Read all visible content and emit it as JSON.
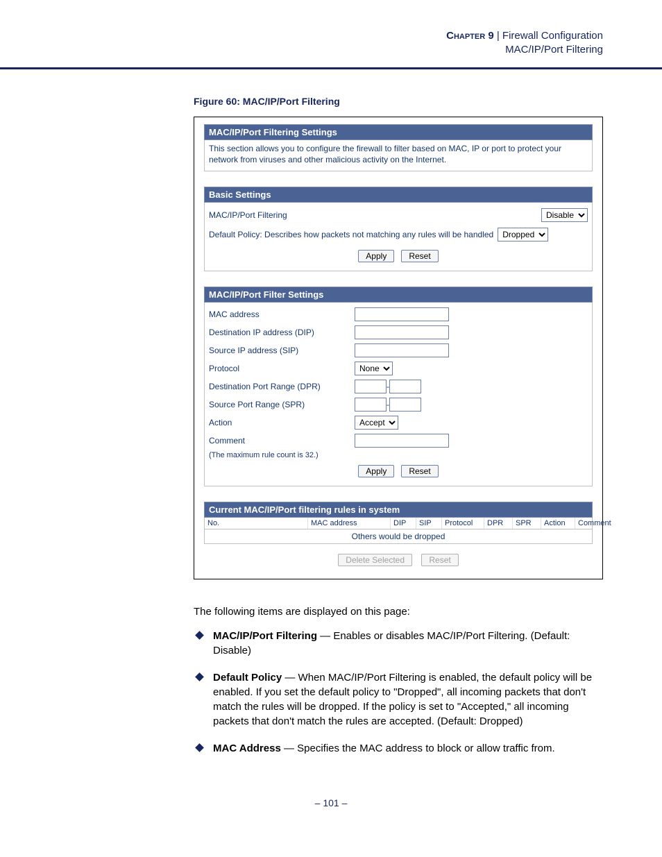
{
  "header": {
    "chapter": "Chapter 9",
    "sep": "  |  ",
    "title": "Firewall Configuration",
    "subtitle": "MAC/IP/Port Filtering"
  },
  "figure_caption": "Figure 60:  MAC/IP/Port Filtering",
  "panel1": {
    "title": "MAC/IP/Port Filtering Settings",
    "desc": "This section allows you to configure the firewall to filter based on MAC, IP or port to protect your network from viruses and other malicious activity on the Internet."
  },
  "panel2": {
    "title": "Basic Settings",
    "row1_label": "MAC/IP/Port Filtering",
    "row1_value": "Disable",
    "row2_label": "Default Policy: Describes how packets not matching any rules will be handled",
    "row2_value": "Dropped",
    "apply": "Apply",
    "reset": "Reset"
  },
  "panel3": {
    "title": "MAC/IP/Port Filter Settings",
    "fields": {
      "mac": "MAC address",
      "dip": "Destination IP address (DIP)",
      "sip": "Source IP address (SIP)",
      "proto": "Protocol",
      "proto_value": "None",
      "dpr": "Destination Port Range (DPR)",
      "spr": "Source Port Range (SPR)",
      "action": "Action",
      "action_value": "Accept",
      "comment": "Comment"
    },
    "note": "(The maximum rule count is 32.)",
    "apply": "Apply",
    "reset": "Reset"
  },
  "panel4": {
    "title": "Current MAC/IP/Port filtering rules in system",
    "cols": [
      "No.",
      "MAC address",
      "DIP",
      "SIP",
      "Protocol",
      "DPR",
      "SPR",
      "Action",
      "Comment"
    ],
    "msg": "Others would be dropped",
    "del": "Delete Selected",
    "reset": "Reset"
  },
  "body": {
    "intro": "The following items are displayed on this page:",
    "items": [
      {
        "term": "MAC/IP/Port Filtering",
        "text": " — Enables or disables MAC/IP/Port Filtering. (Default: Disable)"
      },
      {
        "term": "Default Policy",
        "text": " — When MAC/IP/Port Filtering is enabled, the default policy will be enabled. If you set the default policy to \"Dropped\", all incoming packets that don't match the rules will be dropped. If the policy is set to \"Accepted,\" all incoming packets that don't match the rules are accepted. (Default: Dropped)"
      },
      {
        "term": "MAC Address",
        "text": " — Specifies the MAC address to block or allow traffic from."
      }
    ]
  },
  "page_number": "–  101  –"
}
